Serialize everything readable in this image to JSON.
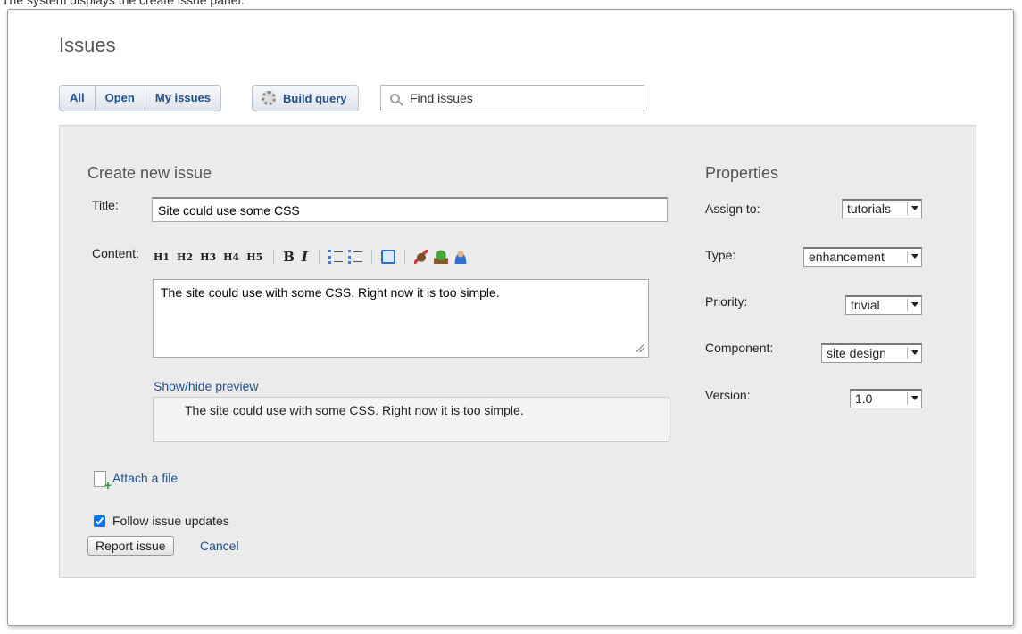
{
  "caption": "The system displays the create issue panel.",
  "page_title": "Issues",
  "filters": {
    "all": "All",
    "open": "Open",
    "my_issues": "My issues"
  },
  "build_query": "Build query",
  "search": {
    "placeholder": "Find issues"
  },
  "create": {
    "heading": "Create new issue",
    "title_label": "Title:",
    "title_value": "Site could use some CSS",
    "content_label": "Content:",
    "toolbar": {
      "h1": "H1",
      "h2": "H2",
      "h3": "H3",
      "h4": "H4",
      "h5": "H5",
      "bold": "B",
      "italic": "I"
    },
    "content_value": "The site could use with some CSS. Right now it is too simple.",
    "preview_toggle": "Show/hide preview",
    "preview_text": "The site could use with some CSS. Right now it is too simple.",
    "attach": "Attach a file",
    "follow_label": "Follow issue updates",
    "follow_checked": true,
    "submit": "Report issue",
    "cancel": "Cancel"
  },
  "properties": {
    "heading": "Properties",
    "assign_label": "Assign to:",
    "assign_value": "tutorials",
    "type_label": "Type:",
    "type_value": "enhancement",
    "priority_label": "Priority:",
    "priority_value": "trivial",
    "component_label": "Component:",
    "component_value": "site design",
    "version_label": "Version:",
    "version_value": "1.0"
  },
  "icons": [
    "gear-icon",
    "search-icon",
    "unordered-list-icon",
    "ordered-list-icon",
    "link-icon",
    "bug-icon",
    "plant-icon",
    "user-icon",
    "file-add-icon",
    "dropdown-arrow-icon"
  ]
}
